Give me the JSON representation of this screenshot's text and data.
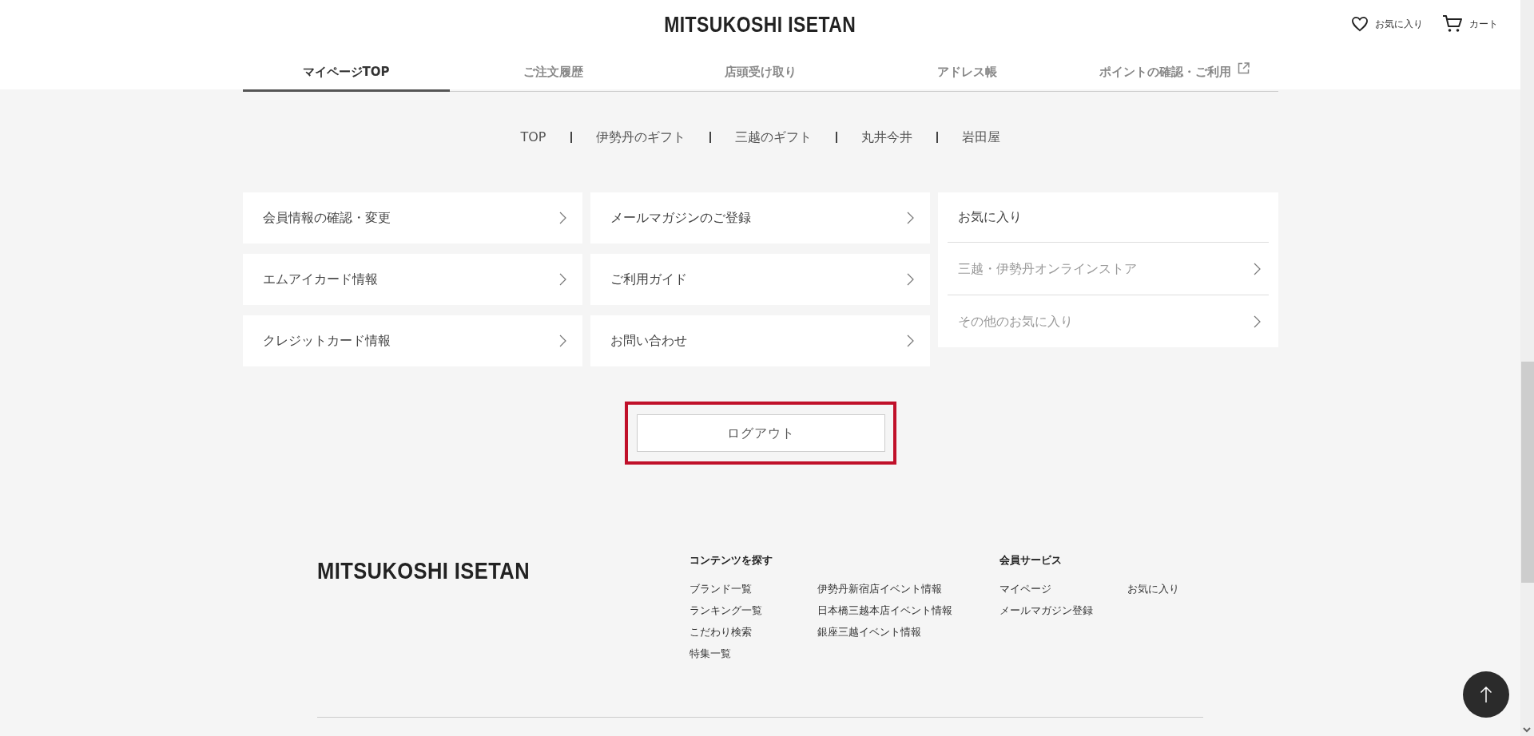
{
  "header": {
    "logo": "MITSUKOSHI ISETAN",
    "actions": [
      {
        "kind": "heart",
        "label": "お気に入り"
      },
      {
        "kind": "cart",
        "label": "カート"
      }
    ]
  },
  "tabs": [
    {
      "label": "マイページTOP",
      "selected": true,
      "external": false
    },
    {
      "label": "ご注文履歴",
      "selected": false,
      "external": false
    },
    {
      "label": "店頭受け取り",
      "selected": false,
      "external": false
    },
    {
      "label": "アドレス帳",
      "selected": false,
      "external": false
    },
    {
      "label": "ポイントの確認・ご利用",
      "selected": false,
      "external": true
    }
  ],
  "store_links": [
    "TOP",
    "伊勢丹のギフト",
    "三越のギフト",
    "丸井今井",
    "岩田屋"
  ],
  "menu_columns": [
    [
      "会員情報の確認・変更",
      "エムアイカード情報",
      "クレジットカード情報"
    ],
    [
      "メールマガジンのご登録",
      "ご利用ガイド",
      "お問い合わせ"
    ]
  ],
  "favorites_panel": {
    "title": "お気に入り",
    "items": [
      "三越・伊勢丹オンラインストア",
      "その他のお気に入り"
    ]
  },
  "logout": {
    "label": "ログアウト",
    "highlighted": true
  },
  "footer": {
    "logo": "MITSUKOSHI ISETAN",
    "sections": [
      {
        "title": "コンテンツを探す",
        "columns": [
          [
            "ブランド一覧",
            "ランキング一覧",
            "こだわり検索",
            "特集一覧"
          ],
          [
            "伊勢丹新宿店イベント情報",
            "日本橋三越本店イベント情報",
            "銀座三越イベント情報"
          ]
        ]
      },
      {
        "title": "会員サービス",
        "columns": [
          [
            "マイページ",
            "メールマガジン登録"
          ],
          [
            "お気に入り"
          ]
        ]
      }
    ]
  }
}
